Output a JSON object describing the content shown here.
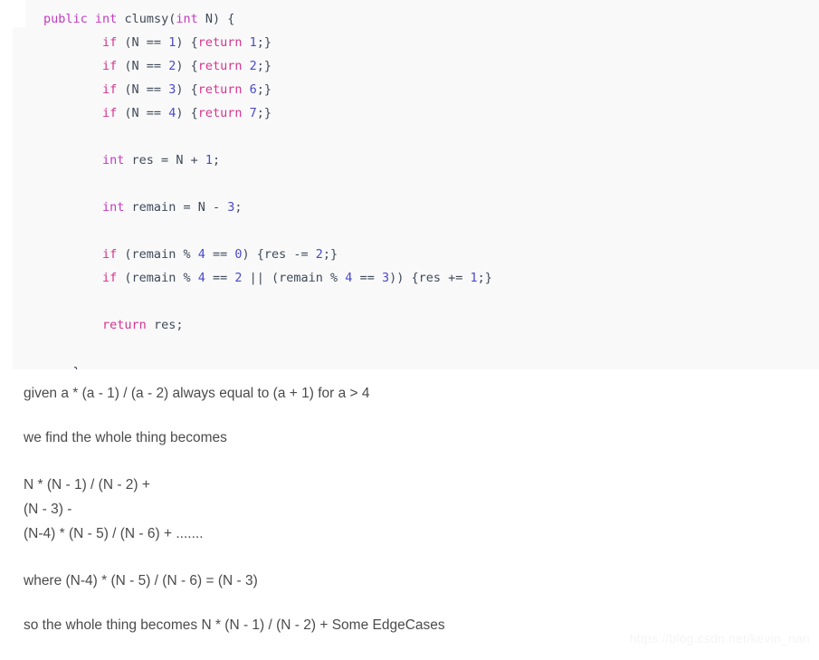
{
  "code_block": {
    "language": "java",
    "background_color": "#f9f9fa",
    "lines": [
      {
        "indent": 0,
        "tokens": [
          {
            "t": "public",
            "c": "kw"
          },
          {
            "t": " ",
            "c": "plain"
          },
          {
            "t": "int",
            "c": "kw"
          },
          {
            "t": " clumsy(",
            "c": "plain"
          },
          {
            "t": "int",
            "c": "kw"
          },
          {
            "t": " N) {",
            "c": "plain"
          }
        ]
      },
      {
        "indent": 1,
        "tokens": [
          {
            "t": "if",
            "c": "ret"
          },
          {
            "t": " (N == ",
            "c": "plain"
          },
          {
            "t": "1",
            "c": "num"
          },
          {
            "t": ") {",
            "c": "plain"
          },
          {
            "t": "return",
            "c": "ret"
          },
          {
            "t": " ",
            "c": "plain"
          },
          {
            "t": "1",
            "c": "num"
          },
          {
            "t": ";}",
            "c": "plain"
          }
        ]
      },
      {
        "indent": 1,
        "tokens": [
          {
            "t": "if",
            "c": "ret"
          },
          {
            "t": " (N == ",
            "c": "plain"
          },
          {
            "t": "2",
            "c": "num"
          },
          {
            "t": ") {",
            "c": "plain"
          },
          {
            "t": "return",
            "c": "ret"
          },
          {
            "t": " ",
            "c": "plain"
          },
          {
            "t": "2",
            "c": "num"
          },
          {
            "t": ";}",
            "c": "plain"
          }
        ]
      },
      {
        "indent": 1,
        "tokens": [
          {
            "t": "if",
            "c": "ret"
          },
          {
            "t": " (N == ",
            "c": "plain"
          },
          {
            "t": "3",
            "c": "num"
          },
          {
            "t": ") {",
            "c": "plain"
          },
          {
            "t": "return",
            "c": "ret"
          },
          {
            "t": " ",
            "c": "plain"
          },
          {
            "t": "6",
            "c": "num"
          },
          {
            "t": ";}",
            "c": "plain"
          }
        ]
      },
      {
        "indent": 1,
        "tokens": [
          {
            "t": "if",
            "c": "ret"
          },
          {
            "t": " (N == ",
            "c": "plain"
          },
          {
            "t": "4",
            "c": "num"
          },
          {
            "t": ") {",
            "c": "plain"
          },
          {
            "t": "return",
            "c": "ret"
          },
          {
            "t": " ",
            "c": "plain"
          },
          {
            "t": "7",
            "c": "num"
          },
          {
            "t": ";}",
            "c": "plain"
          }
        ]
      },
      {
        "indent": 0,
        "tokens": []
      },
      {
        "indent": 1,
        "tokens": [
          {
            "t": "int",
            "c": "kw"
          },
          {
            "t": " res = N + ",
            "c": "plain"
          },
          {
            "t": "1",
            "c": "num"
          },
          {
            "t": ";",
            "c": "plain"
          }
        ]
      },
      {
        "indent": 0,
        "tokens": []
      },
      {
        "indent": 1,
        "tokens": [
          {
            "t": "int",
            "c": "kw"
          },
          {
            "t": " remain = N - ",
            "c": "plain"
          },
          {
            "t": "3",
            "c": "num"
          },
          {
            "t": ";",
            "c": "plain"
          }
        ]
      },
      {
        "indent": 0,
        "tokens": []
      },
      {
        "indent": 1,
        "tokens": [
          {
            "t": "if",
            "c": "ret"
          },
          {
            "t": " (remain % ",
            "c": "plain"
          },
          {
            "t": "4",
            "c": "num"
          },
          {
            "t": " == ",
            "c": "plain"
          },
          {
            "t": "0",
            "c": "num"
          },
          {
            "t": ") {res -= ",
            "c": "plain"
          },
          {
            "t": "2",
            "c": "num"
          },
          {
            "t": ";}",
            "c": "plain"
          }
        ]
      },
      {
        "indent": 1,
        "tokens": [
          {
            "t": "if",
            "c": "ret"
          },
          {
            "t": " (remain % ",
            "c": "plain"
          },
          {
            "t": "4",
            "c": "num"
          },
          {
            "t": " == ",
            "c": "plain"
          },
          {
            "t": "2",
            "c": "num"
          },
          {
            "t": " || (remain % ",
            "c": "plain"
          },
          {
            "t": "4",
            "c": "num"
          },
          {
            "t": " == ",
            "c": "plain"
          },
          {
            "t": "3",
            "c": "num"
          },
          {
            "t": ")) {res += ",
            "c": "plain"
          },
          {
            "t": "1",
            "c": "num"
          },
          {
            "t": ";}",
            "c": "plain"
          }
        ]
      },
      {
        "indent": 0,
        "tokens": []
      },
      {
        "indent": 1,
        "tokens": [
          {
            "t": "return",
            "c": "ret"
          },
          {
            "t": " res;",
            "c": "plain"
          }
        ]
      },
      {
        "indent": 0,
        "tokens": []
      },
      {
        "indent": 0,
        "tokens": [
          {
            "t": "    }",
            "c": "plain"
          }
        ]
      }
    ]
  },
  "prose": {
    "paragraph_1": "given a * (a - 1) / (a - 2) always equal to (a + 1) for a > 4",
    "paragraph_2": "we find the whole thing becomes",
    "formula_lines": [
      "N * (N - 1) / (N - 2) +",
      "(N - 3) -",
      "(N-4) * (N - 5) / (N - 6) + ......."
    ],
    "paragraph_3": "where (N-4) * (N - 5) / (N - 6) = (N - 3)",
    "paragraph_4": "so the whole thing becomes N * (N - 1) / (N - 2) + Some EdgeCases"
  },
  "watermark": {
    "text": "https://blog.csdn.net/kevin_nan",
    "color": "#f4f5f6"
  }
}
